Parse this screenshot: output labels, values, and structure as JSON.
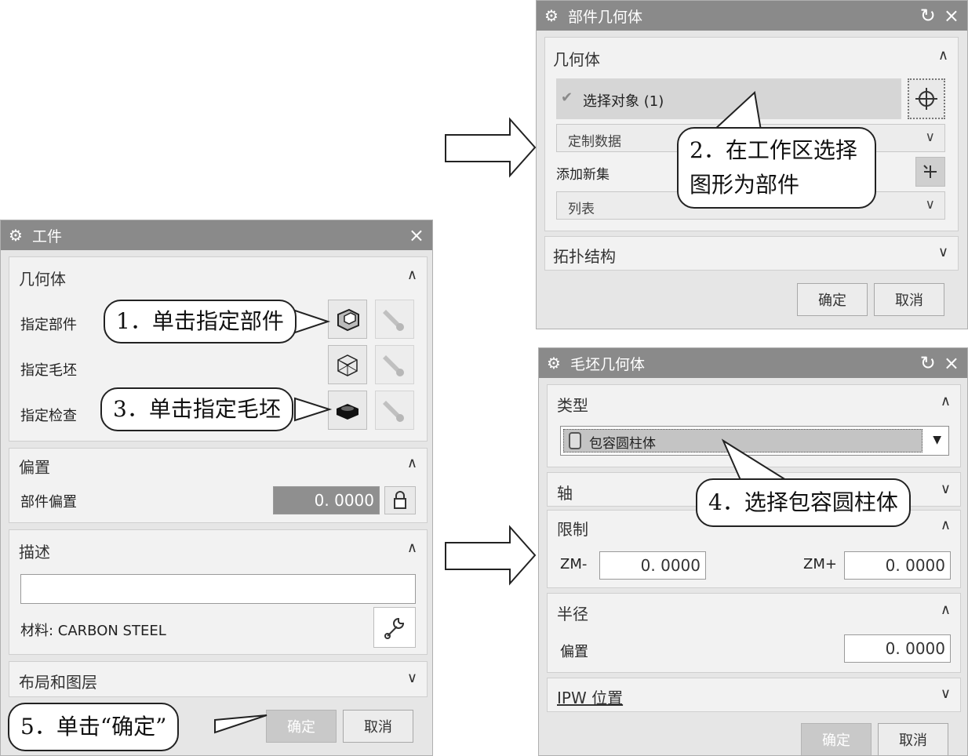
{
  "workpiece": {
    "title": "工件",
    "close": "×",
    "geometry": {
      "header": "几何体",
      "rows": [
        {
          "label": "指定部件"
        },
        {
          "label": "指定毛坯"
        },
        {
          "label": "指定检查"
        }
      ]
    },
    "offset": {
      "header": "偏置",
      "label": "部件偏置",
      "value": "0. 0000"
    },
    "description": {
      "header": "描述",
      "material": "材料: CARBON STEEL"
    },
    "layout": {
      "header": "布局和图层"
    },
    "ok": "确定",
    "cancel": "取消"
  },
  "part_geometry": {
    "title": "部件几何体",
    "reset": "↻",
    "close": "×",
    "geometry_header": "几何体",
    "select_object": "选择对象 (1)",
    "custom_data": "定制数据",
    "add_new_set": "添加新集",
    "list": "列表",
    "topology": "拓扑结构",
    "ok": "确定",
    "cancel": "取消"
  },
  "blank_geometry": {
    "title": "毛坯几何体",
    "reset": "↻",
    "close": "×",
    "type_header": "类型",
    "type_value": "包容圆柱体",
    "axis_header": "轴",
    "limit_header": "限制",
    "zm_minus_label": "ZM-",
    "zm_minus_value": "0. 0000",
    "zm_plus_label": "ZM+",
    "zm_plus_value": "0. 0000",
    "radius_header": "半径",
    "offset_label": "偏置",
    "offset_value": "0. 0000",
    "ipw_header": "IPW 位置",
    "ok": "确定",
    "cancel": "取消"
  },
  "callouts": {
    "step1": "1．单击指定部件",
    "step2_line1": "2．在工作区选择",
    "step2_line2": "图形为部件",
    "step3": "3．单击指定毛坯",
    "step4": "4．选择包容圆柱体",
    "step5": "5．单击“确定”"
  }
}
